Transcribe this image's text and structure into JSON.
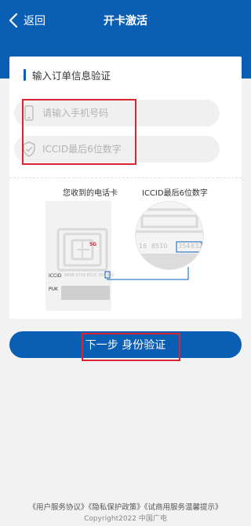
{
  "header": {
    "back_label": "返回",
    "title": "开卡激活"
  },
  "form": {
    "section_title": "输入订单信息验证",
    "phone_placeholder": "请输入手机号码",
    "iccid_placeholder": "ICCID最后6位数字"
  },
  "illustration": {
    "sim_caption": "您收到的电话卡",
    "iccid_caption": "ICCID最后6位数字",
    "sim_logo": "5G",
    "iccid_label": "ICCID",
    "puk_label": "PUK",
    "iccid_digits_small": "8956 0719 8510 354 832",
    "iccid_digits_zoom_1": "16",
    "iccid_digits_zoom_2": "8510",
    "iccid_digits_zoom_3": "354",
    "iccid_digits_zoom_4": "832"
  },
  "submit": {
    "label": "下一步 身份验证"
  },
  "footer": {
    "links": [
      "《用户服务协议》",
      "《隐私保护政策》",
      "《试商用服务温馨提示》"
    ],
    "copyright": "Copyright2022 中国广电"
  },
  "colors": {
    "primary": "#0a5fb4",
    "highlight": "#d9252f"
  }
}
